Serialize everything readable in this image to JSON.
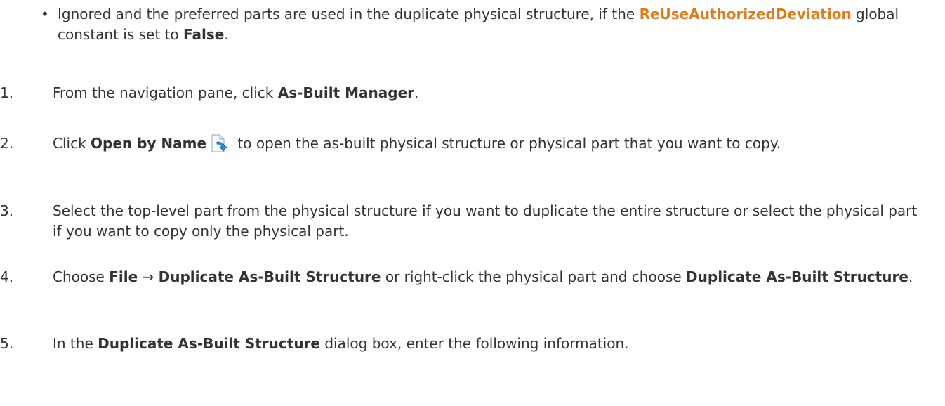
{
  "bullet": {
    "symbol": "•",
    "text_a": "Ignored and the preferred parts are used in the duplicate physical structure, if the ",
    "constant": "ReUseAuthorizedDeviation",
    "text_b": " global constant is set to ",
    "value": "False",
    "text_c": "."
  },
  "steps": [
    {
      "num": "1.",
      "pre": "From the navigation pane, click ",
      "bold1": "As-Built Manager",
      "post": "."
    },
    {
      "num": "2.",
      "pre": "Click ",
      "bold1": "Open by Name",
      "icon": "open-by-name-icon",
      "post": " to open the as-built physical structure or physical part that you want to copy."
    },
    {
      "num": "3.",
      "text": "Select the top-level part from the physical structure if you want to duplicate the entire structure or select the physical part if you want to copy only the physical part."
    },
    {
      "num": "4.",
      "pre": "Choose ",
      "bold1": "File",
      "arrow": " → ",
      "bold2": "Duplicate As-Built Structure",
      "mid": " or right-click the physical part and choose ",
      "bold3": "Duplicate As-Built Structure",
      "post": "."
    },
    {
      "num": "5.",
      "pre": "In the ",
      "bold1": "Duplicate As-Built Structure",
      "post": " dialog box, enter the following information."
    }
  ],
  "colors": {
    "text": "#333333",
    "constant": "#e07b1a"
  }
}
